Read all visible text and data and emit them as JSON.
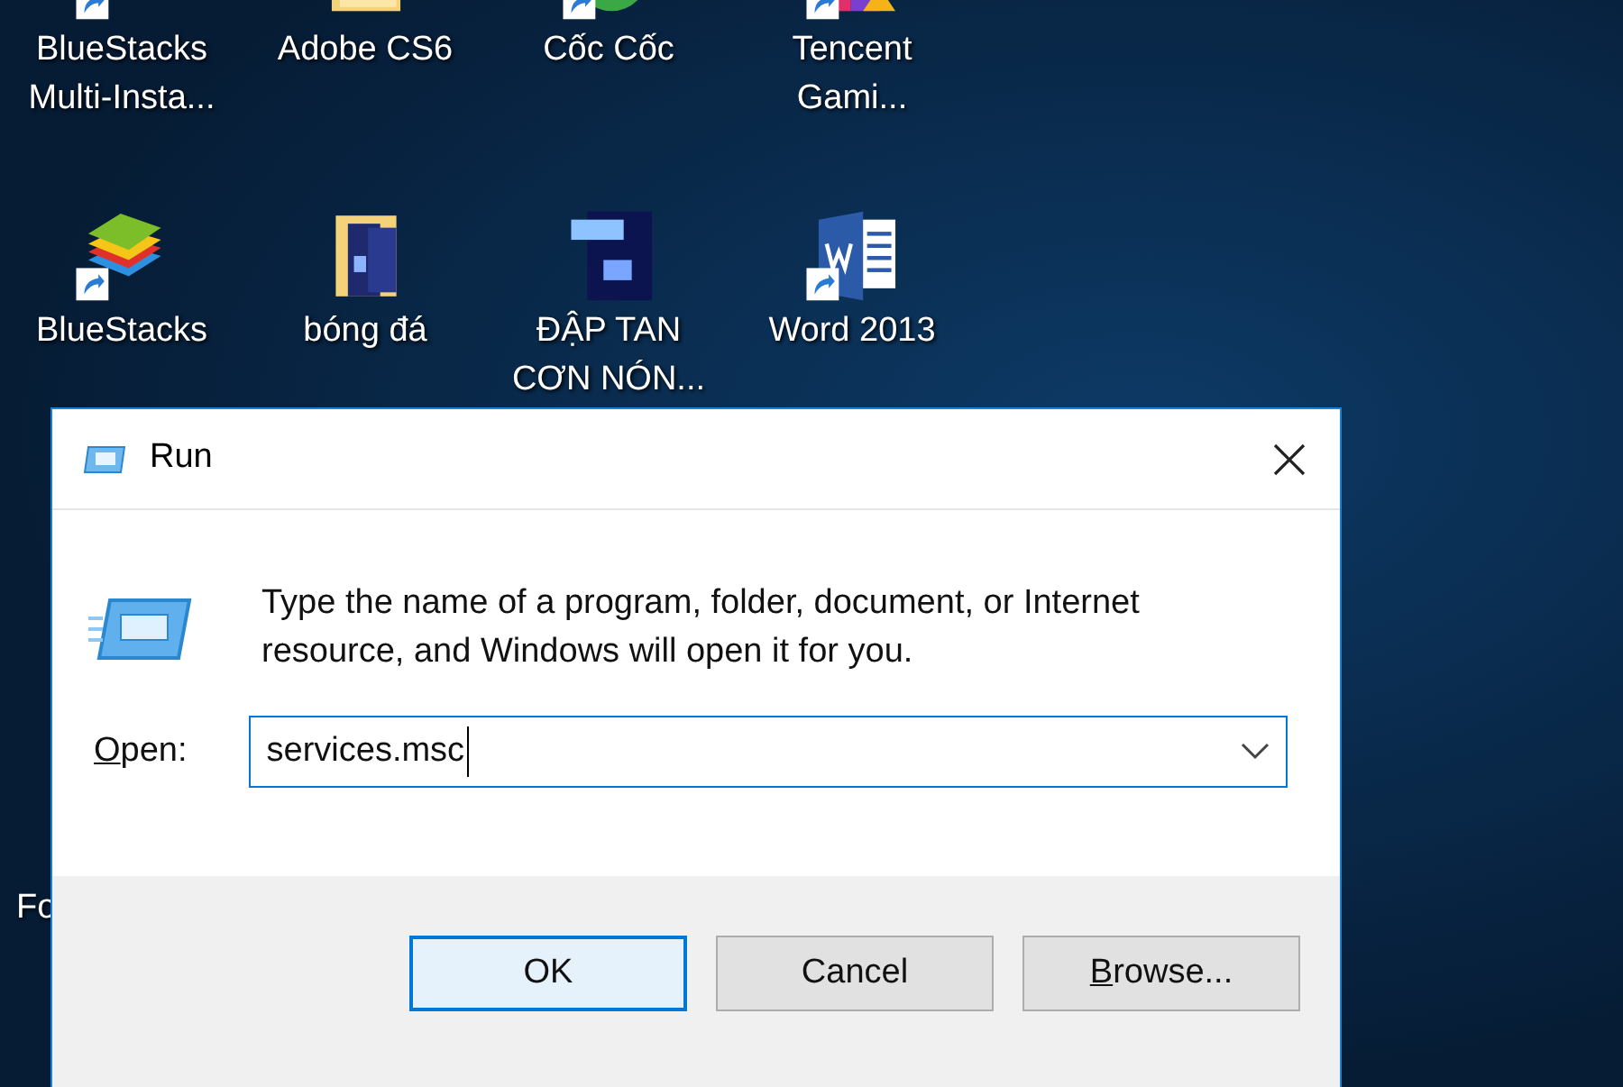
{
  "desktop_icons": [
    {
      "label": "BlueStacks Multi-Insta...",
      "kind": "stack",
      "shortcut": true
    },
    {
      "label": "Adobe CS6",
      "kind": "folder",
      "shortcut": false
    },
    {
      "label": "Cốc Cốc",
      "kind": "globe",
      "shortcut": true
    },
    {
      "label": "Tencent Gami...",
      "kind": "colorful",
      "shortcut": true
    },
    {
      "label": "BlueStacks",
      "kind": "stack",
      "shortcut": true
    },
    {
      "label": "bóng đá",
      "kind": "ps-folder",
      "shortcut": false
    },
    {
      "label": "ĐẬP TAN CƠN NÓN...",
      "kind": "psd",
      "shortcut": false
    },
    {
      "label": "Word 2013",
      "kind": "word",
      "shortcut": true
    }
  ],
  "hidden_icon_label": "Fo",
  "dialog": {
    "title": "Run",
    "message": "Type the name of a program, folder, document, or Internet resource, and Windows will open it for you.",
    "open_label": {
      "text": "Open:",
      "first_letter_underlined": true
    },
    "open_value": "services.msc",
    "buttons": [
      {
        "label": "OK",
        "default": true,
        "first_letter_underlined": false
      },
      {
        "label": "Cancel",
        "default": false,
        "first_letter_underlined": false
      },
      {
        "label": "Browse...",
        "default": false,
        "first_letter_underlined": true
      }
    ]
  }
}
